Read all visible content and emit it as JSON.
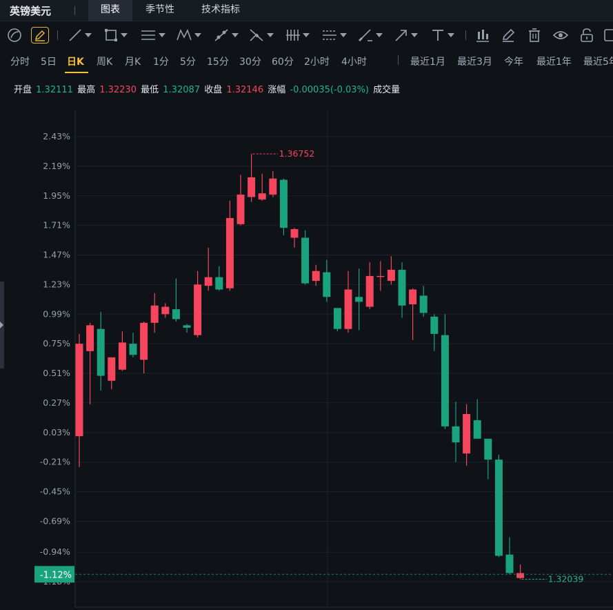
{
  "header": {
    "symbol": "英镑美元",
    "tabs": [
      {
        "label": "图表",
        "active": true
      },
      {
        "label": "季节性",
        "active": false
      },
      {
        "label": "技术指标",
        "active": false
      }
    ]
  },
  "toolbar": {
    "tools": [
      "cursor-icon",
      "pencil-icon",
      "line-tool-icon",
      "rectangle-tool-icon",
      "parallel-lines-icon",
      "pattern-tool-icon",
      "brush-tool-icon",
      "fib-tool-icon",
      "ruler-tool-icon",
      "measure-tool-icon",
      "paint-tool-icon",
      "arrow-tool-icon",
      "text-tool-icon",
      "chart-style-icon",
      "edit-icon",
      "trash-icon",
      "eye-icon",
      "lock-icon",
      "layout-icon"
    ]
  },
  "periods": {
    "left": [
      "分时",
      "5日",
      "日K",
      "周K",
      "月K",
      "1分",
      "5分",
      "15分",
      "30分",
      "60分",
      "2小时",
      "4小时"
    ],
    "active": "日K",
    "right": [
      "最近1月",
      "最近3月",
      "今年",
      "最近1年",
      "最近5年"
    ]
  },
  "ohlc": {
    "open_label": "开盘",
    "open": "1.32111",
    "high_label": "最高",
    "high": "1.32230",
    "low_label": "最低",
    "low": "1.32087",
    "close_label": "收盘",
    "close": "1.32146",
    "change_label": "涨幅",
    "change": "-0.00035(-0.03%)",
    "volume_label": "成交量"
  },
  "colors": {
    "up": "#f6465d",
    "down": "#1ba27f",
    "background": "#0f1217",
    "grid": "#1f232b",
    "accent": "#f5c13d"
  },
  "chart_data": {
    "type": "candlestick",
    "y_axis_unit": "percent",
    "y_ticks": [
      "2.43%",
      "2.19%",
      "1.95%",
      "1.71%",
      "1.47%",
      "1.23%",
      "0.99%",
      "0.75%",
      "0.51%",
      "0.27%",
      "0.03%",
      "-0.21%",
      "-0.45%",
      "-0.69%",
      "-0.94%",
      "-1.18%"
    ],
    "y_tick_values": [
      2.43,
      2.19,
      1.95,
      1.71,
      1.47,
      1.23,
      0.99,
      0.75,
      0.51,
      0.27,
      0.03,
      -0.21,
      -0.45,
      -0.69,
      -0.94,
      -1.18
    ],
    "current_label": "-1.12%",
    "current_value": -1.12,
    "max_label": "1.36752",
    "max_value": 2.29,
    "min_label": "1.32039",
    "min_value": -1.16,
    "candles": [
      {
        "o": 0.0,
        "h": 0.83,
        "l": -0.25,
        "c": 0.75
      },
      {
        "o": 0.69,
        "h": 0.92,
        "l": 0.26,
        "c": 0.9
      },
      {
        "o": 0.87,
        "h": 1.01,
        "l": 0.37,
        "c": 0.49
      },
      {
        "o": 0.45,
        "h": 0.58,
        "l": 0.38,
        "c": 0.64
      },
      {
        "o": 0.54,
        "h": 0.85,
        "l": 0.53,
        "c": 0.76
      },
      {
        "o": 0.75,
        "h": 0.84,
        "l": 0.64,
        "c": 0.66
      },
      {
        "o": 0.62,
        "h": 0.93,
        "l": 0.51,
        "c": 0.92
      },
      {
        "o": 0.92,
        "h": 1.16,
        "l": 0.84,
        "c": 1.06
      },
      {
        "o": 0.99,
        "h": 1.08,
        "l": 0.96,
        "c": 1.05
      },
      {
        "o": 1.03,
        "h": 1.28,
        "l": 0.93,
        "c": 0.95
      },
      {
        "o": 0.9,
        "h": 0.91,
        "l": 0.84,
        "c": 0.88
      },
      {
        "o": 0.82,
        "h": 1.34,
        "l": 0.8,
        "c": 1.23
      },
      {
        "o": 1.22,
        "h": 1.53,
        "l": 1.18,
        "c": 1.29
      },
      {
        "o": 1.29,
        "h": 1.38,
        "l": 1.18,
        "c": 1.19
      },
      {
        "o": 1.2,
        "h": 1.91,
        "l": 1.18,
        "c": 1.77
      },
      {
        "o": 1.72,
        "h": 2.12,
        "l": 1.71,
        "c": 1.96
      },
      {
        "o": 1.94,
        "h": 2.29,
        "l": 1.9,
        "c": 2.1
      },
      {
        "o": 1.92,
        "h": 2.13,
        "l": 1.91,
        "c": 1.97
      },
      {
        "o": 1.96,
        "h": 2.15,
        "l": 1.94,
        "c": 2.09
      },
      {
        "o": 2.08,
        "h": 2.09,
        "l": 1.63,
        "c": 1.69
      },
      {
        "o": 1.61,
        "h": 1.69,
        "l": 1.53,
        "c": 1.68
      },
      {
        "o": 1.61,
        "h": 1.67,
        "l": 1.23,
        "c": 1.24
      },
      {
        "o": 1.26,
        "h": 1.39,
        "l": 1.22,
        "c": 1.34
      },
      {
        "o": 1.33,
        "h": 1.43,
        "l": 1.09,
        "c": 1.13
      },
      {
        "o": 1.04,
        "h": 1.04,
        "l": 0.85,
        "c": 0.87
      },
      {
        "o": 0.87,
        "h": 1.34,
        "l": 0.84,
        "c": 1.19
      },
      {
        "o": 1.13,
        "h": 1.36,
        "l": 0.86,
        "c": 1.09
      },
      {
        "o": 1.05,
        "h": 1.41,
        "l": 1.03,
        "c": 1.3
      },
      {
        "o": 1.3,
        "h": 1.42,
        "l": 1.18,
        "c": 1.3
      },
      {
        "o": 1.26,
        "h": 1.46,
        "l": 1.23,
        "c": 1.35
      },
      {
        "o": 1.35,
        "h": 1.41,
        "l": 0.96,
        "c": 1.06
      },
      {
        "o": 1.07,
        "h": 1.2,
        "l": 0.78,
        "c": 1.19
      },
      {
        "o": 1.14,
        "h": 1.22,
        "l": 0.97,
        "c": 1.0
      },
      {
        "o": 0.97,
        "h": 0.99,
        "l": 0.69,
        "c": 0.83
      },
      {
        "o": 0.82,
        "h": 0.99,
        "l": 0.06,
        "c": 0.08
      },
      {
        "o": 0.08,
        "h": 0.28,
        "l": -0.21,
        "c": -0.05
      },
      {
        "o": -0.14,
        "h": 0.26,
        "l": -0.24,
        "c": 0.18
      },
      {
        "o": 0.13,
        "h": 0.3,
        "l": -0.02,
        "c": -0.02
      },
      {
        "o": -0.02,
        "h": -0.06,
        "l": -0.35,
        "c": -0.19
      },
      {
        "o": -0.19,
        "h": -0.15,
        "l": -0.98,
        "c": -0.97
      },
      {
        "o": -0.96,
        "h": -0.82,
        "l": -1.12,
        "c": -1.11
      },
      {
        "o": -1.15,
        "h": -1.04,
        "l": -1.16,
        "c": -1.11
      }
    ]
  }
}
